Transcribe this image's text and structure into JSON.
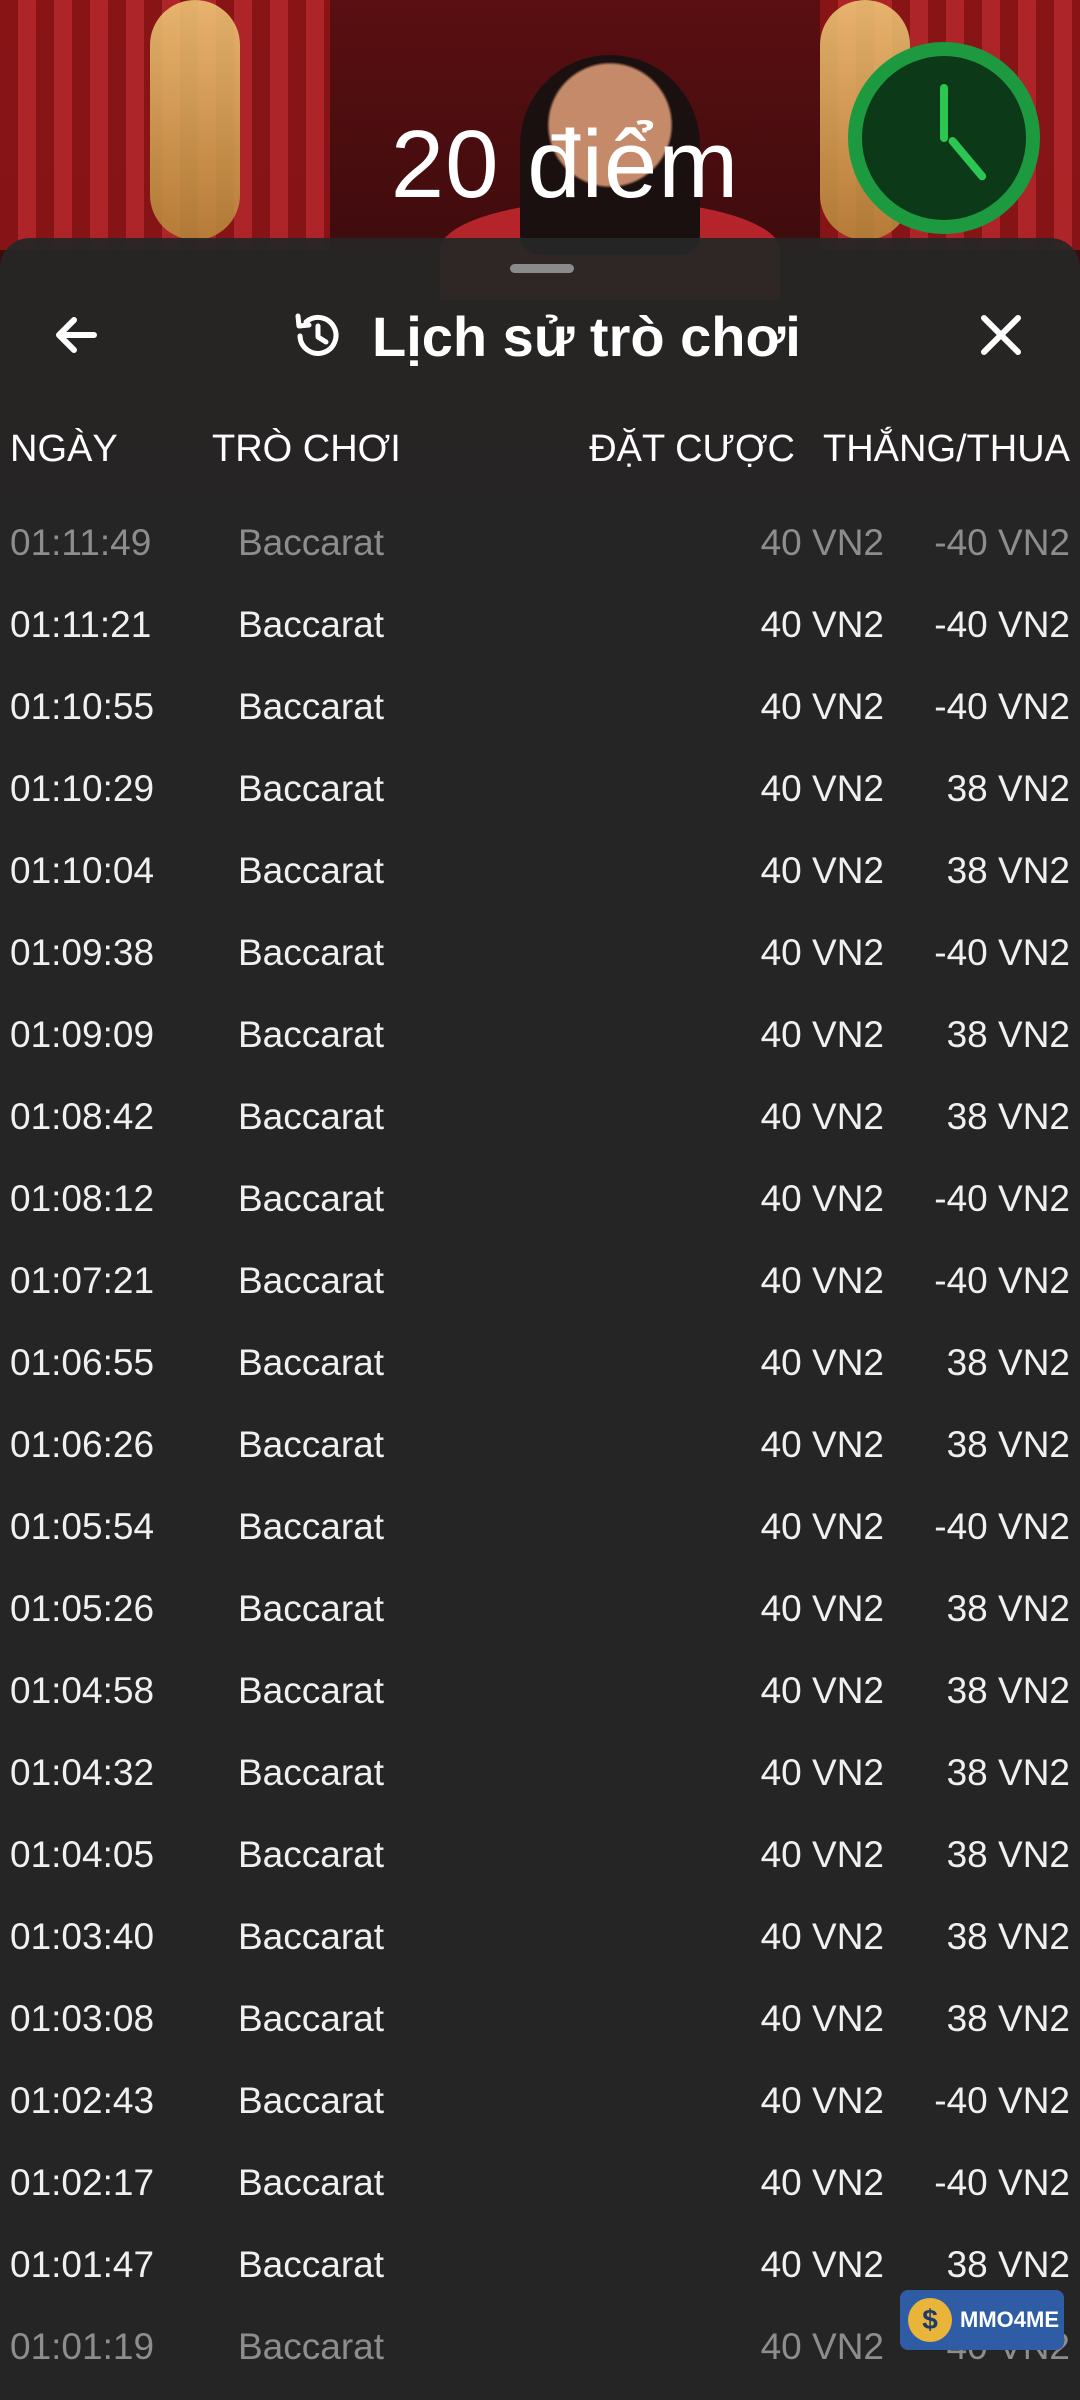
{
  "game": {
    "score_text": "20 điểm"
  },
  "history": {
    "title": "Lịch sử trò chơi",
    "columns": {
      "date": "NGÀY",
      "game": "TRÒ CHƠI",
      "bet": "ĐẶT CƯỢC",
      "win_loss": "THẮNG/THUA"
    },
    "rows": [
      {
        "time": "01:11:49",
        "game": "Baccarat",
        "bet": "40 VN2",
        "result": "-40 VN2"
      },
      {
        "time": "01:11:21",
        "game": "Baccarat",
        "bet": "40 VN2",
        "result": "-40 VN2"
      },
      {
        "time": "01:10:55",
        "game": "Baccarat",
        "bet": "40 VN2",
        "result": "-40 VN2"
      },
      {
        "time": "01:10:29",
        "game": "Baccarat",
        "bet": "40 VN2",
        "result": "38 VN2"
      },
      {
        "time": "01:10:04",
        "game": "Baccarat",
        "bet": "40 VN2",
        "result": "38 VN2"
      },
      {
        "time": "01:09:38",
        "game": "Baccarat",
        "bet": "40 VN2",
        "result": "-40 VN2"
      },
      {
        "time": "01:09:09",
        "game": "Baccarat",
        "bet": "40 VN2",
        "result": "38 VN2"
      },
      {
        "time": "01:08:42",
        "game": "Baccarat",
        "bet": "40 VN2",
        "result": "38 VN2"
      },
      {
        "time": "01:08:12",
        "game": "Baccarat",
        "bet": "40 VN2",
        "result": "-40 VN2"
      },
      {
        "time": "01:07:21",
        "game": "Baccarat",
        "bet": "40 VN2",
        "result": "-40 VN2"
      },
      {
        "time": "01:06:55",
        "game": "Baccarat",
        "bet": "40 VN2",
        "result": "38 VN2"
      },
      {
        "time": "01:06:26",
        "game": "Baccarat",
        "bet": "40 VN2",
        "result": "38 VN2"
      },
      {
        "time": "01:05:54",
        "game": "Baccarat",
        "bet": "40 VN2",
        "result": "-40 VN2"
      },
      {
        "time": "01:05:26",
        "game": "Baccarat",
        "bet": "40 VN2",
        "result": "38 VN2"
      },
      {
        "time": "01:04:58",
        "game": "Baccarat",
        "bet": "40 VN2",
        "result": "38 VN2"
      },
      {
        "time": "01:04:32",
        "game": "Baccarat",
        "bet": "40 VN2",
        "result": "38 VN2"
      },
      {
        "time": "01:04:05",
        "game": "Baccarat",
        "bet": "40 VN2",
        "result": "38 VN2"
      },
      {
        "time": "01:03:40",
        "game": "Baccarat",
        "bet": "40 VN2",
        "result": "38 VN2"
      },
      {
        "time": "01:03:08",
        "game": "Baccarat",
        "bet": "40 VN2",
        "result": "38 VN2"
      },
      {
        "time": "01:02:43",
        "game": "Baccarat",
        "bet": "40 VN2",
        "result": "-40 VN2"
      },
      {
        "time": "01:02:17",
        "game": "Baccarat",
        "bet": "40 VN2",
        "result": "-40 VN2"
      },
      {
        "time": "01:01:47",
        "game": "Baccarat",
        "bet": "40 VN2",
        "result": "38 VN2"
      },
      {
        "time": "01:01:19",
        "game": "Baccarat",
        "bet": "40 VN2",
        "result": "40 VN2"
      }
    ]
  },
  "watermark": {
    "text": "MMO4ME",
    "coin_symbol": "$"
  },
  "icons": {
    "back": "arrow-left-icon",
    "history": "history-clock-icon",
    "close": "close-icon",
    "timer": "timer-icon"
  },
  "colors": {
    "timer_ring": "#1d9a40",
    "sheet_bg": "#262626",
    "watermark_bg": "#2e5da5"
  }
}
